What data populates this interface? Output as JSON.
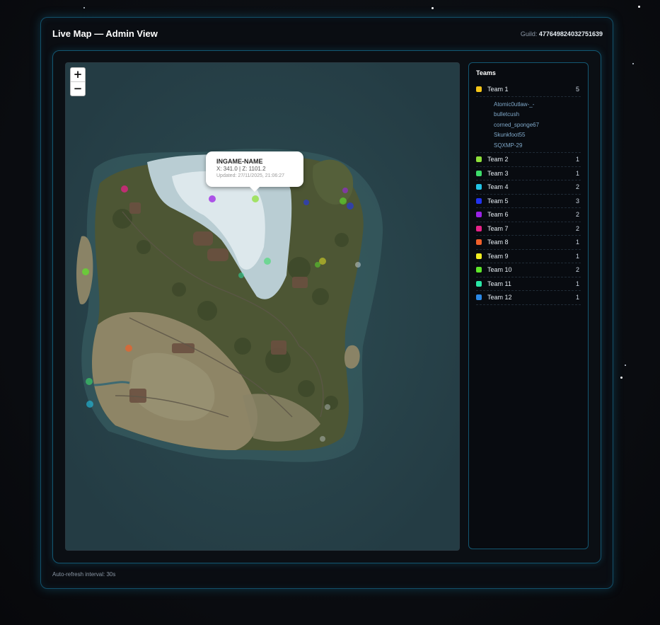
{
  "header": {
    "title": "Live Map — Admin View",
    "guild_label": "Guild:",
    "guild_id": "477649824032751639"
  },
  "map": {
    "zoom_in_label": "+",
    "zoom_out_label": "−",
    "popup": {
      "name": "INGAME-NAME",
      "coords": "X: 341.0 | Z: 1101.2",
      "updated": "Updated: 27/11/2025, 21:06:27"
    }
  },
  "teams_panel": {
    "title": "Teams",
    "teams": [
      {
        "name": "Team 1",
        "count": "5",
        "color": "#f5c518",
        "members": [
          "Atomic0utlaw-_-",
          "bulletcush",
          "corned_sponge67",
          "Skunkfoot55",
          "SQXMP-29"
        ]
      },
      {
        "name": "Team 2",
        "count": "1",
        "color": "#8ee03a"
      },
      {
        "name": "Team 3",
        "count": "1",
        "color": "#3ddc6a"
      },
      {
        "name": "Team 4",
        "count": "2",
        "color": "#22c3e6"
      },
      {
        "name": "Team 5",
        "count": "3",
        "color": "#2233ee"
      },
      {
        "name": "Team 6",
        "count": "2",
        "color": "#9b22e6"
      },
      {
        "name": "Team 7",
        "count": "2",
        "color": "#e62288"
      },
      {
        "name": "Team 8",
        "count": "1",
        "color": "#f0602a"
      },
      {
        "name": "Team 9",
        "count": "1",
        "color": "#f2ee22"
      },
      {
        "name": "Team 10",
        "count": "2",
        "color": "#5ee62a"
      },
      {
        "name": "Team 11",
        "count": "1",
        "color": "#2ae6a6"
      },
      {
        "name": "Team 12",
        "count": "1",
        "color": "#2a88e6"
      }
    ]
  },
  "footer": {
    "refresh_text": "Auto-refresh interval: 30s"
  }
}
